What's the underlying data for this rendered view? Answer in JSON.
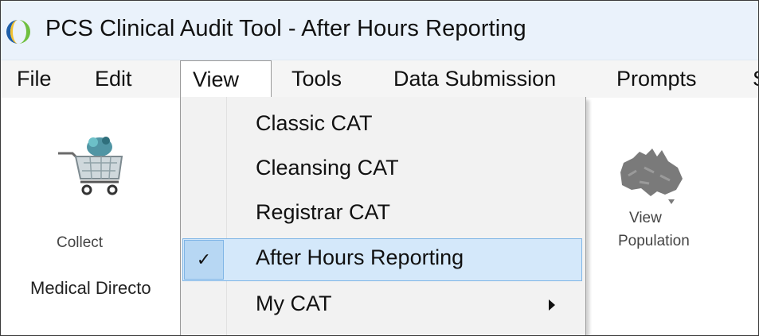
{
  "window": {
    "title": "PCS Clinical Audit Tool - After Hours Reporting"
  },
  "menubar": {
    "items": [
      {
        "label": "File"
      },
      {
        "label": "Edit"
      },
      {
        "label": "View"
      },
      {
        "label": "Tools"
      },
      {
        "label": "Data Submission"
      },
      {
        "label": "Prompts"
      },
      {
        "label": "S"
      }
    ]
  },
  "toolbar": {
    "collect_label": "Collect",
    "group_label": "Medical Directo",
    "view_population_label": [
      "View",
      "Population"
    ]
  },
  "view_menu": {
    "items": [
      {
        "label": "Classic CAT"
      },
      {
        "label": "Cleansing CAT"
      },
      {
        "label": "Registrar CAT"
      },
      {
        "label": "After Hours Reporting",
        "checked": true,
        "check_glyph": "✓"
      },
      {
        "label": "My CAT"
      }
    ]
  },
  "colors": {
    "titlebar": "#eaf2fb",
    "menubar": "#f5f5f5",
    "menu_background": "#f2f2f2",
    "selected_item": "#d4e8fa",
    "check_box": "#b7d7f3",
    "selection_border": "#7fb5e6"
  },
  "icons": {
    "app": "app-logo-icon",
    "collect": "shopping-cart-icon",
    "view_population": "australia-map-icon",
    "checked": "checkmark-icon",
    "submenu": "submenu-arrow-icon"
  }
}
